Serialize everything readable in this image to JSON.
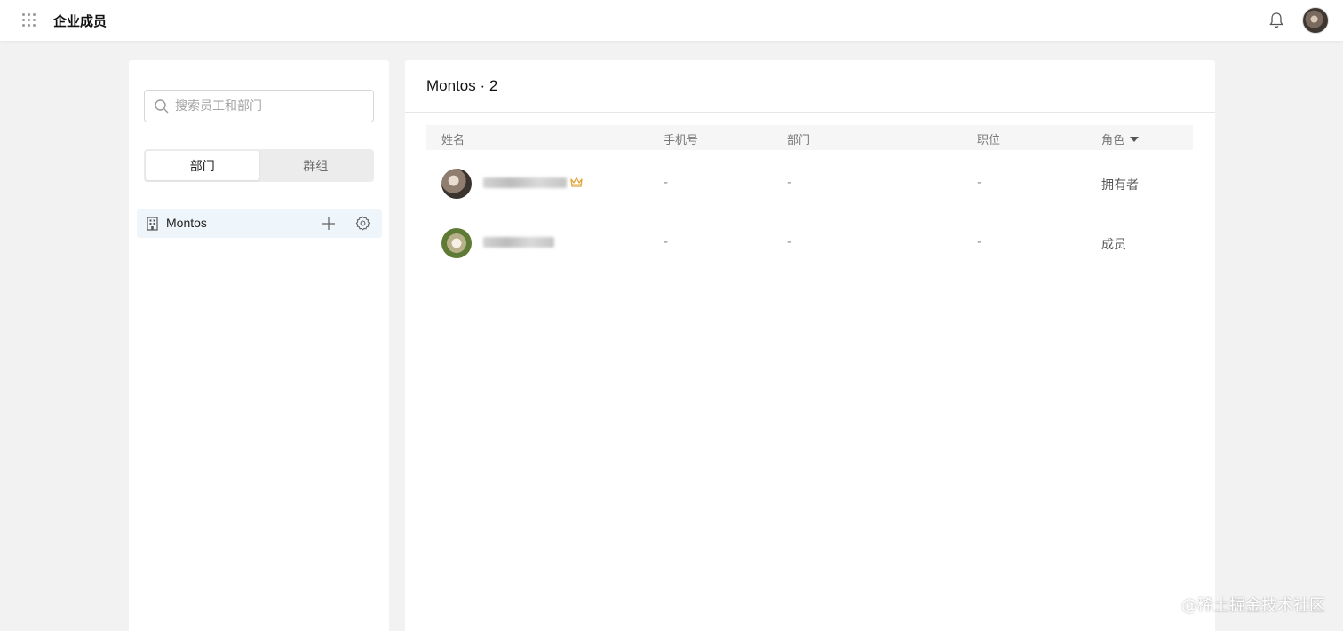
{
  "app": {
    "title": "企业成员"
  },
  "topbar": {
    "icons": [
      "apps-grid-icon",
      "bell-icon",
      "user-avatar"
    ]
  },
  "sidebar": {
    "search_placeholder": "搜索员工和部门",
    "tabs": [
      {
        "label": "部门",
        "active": true
      },
      {
        "label": "群组",
        "active": false
      }
    ],
    "departments": [
      {
        "name": "Montos",
        "icon": "building-icon",
        "actions": [
          "plus-icon",
          "gear-icon"
        ]
      }
    ]
  },
  "main": {
    "title": "Montos · 2",
    "columns": [
      "姓名",
      "手机号",
      "部门",
      "职位",
      "角色"
    ],
    "rows": [
      {
        "phone": "-",
        "department": "-",
        "position": "-",
        "role": "拥有者",
        "badge": "crown-icon"
      },
      {
        "phone": "-",
        "department": "-",
        "position": "-",
        "role": "成员"
      }
    ]
  },
  "watermark": "@稀土掘金技术社区",
  "colors": {
    "accent_row": "#eef6fb",
    "crown": "#e0a43a",
    "background": "#f2f2f2"
  }
}
